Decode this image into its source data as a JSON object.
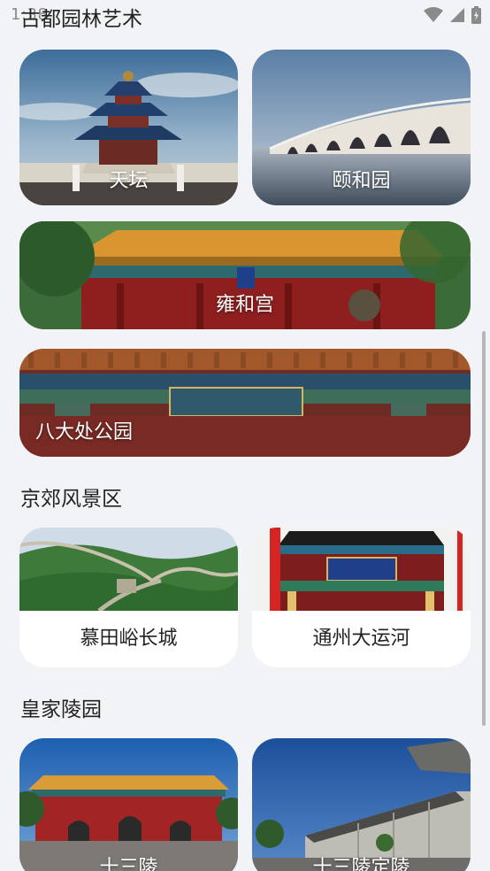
{
  "status_bar": {
    "time": "1:38",
    "icons": [
      "wifi-icon",
      "signal-icon",
      "battery-icon"
    ]
  },
  "sections": {
    "gardens": {
      "title": "古都园林艺术",
      "items": [
        "天坛",
        "颐和园",
        "雍和宫",
        "八大处公园"
      ]
    },
    "suburbs": {
      "title": "京郊风景区",
      "items": [
        "慕田峪长城",
        "通州大运河"
      ]
    },
    "tombs": {
      "title": "皇家陵园",
      "items": [
        "十三陵",
        "十三陵定陵"
      ]
    }
  },
  "colors": {
    "background": "#f2f3f6",
    "card": "#ffffff",
    "caption": "#ffffff"
  }
}
